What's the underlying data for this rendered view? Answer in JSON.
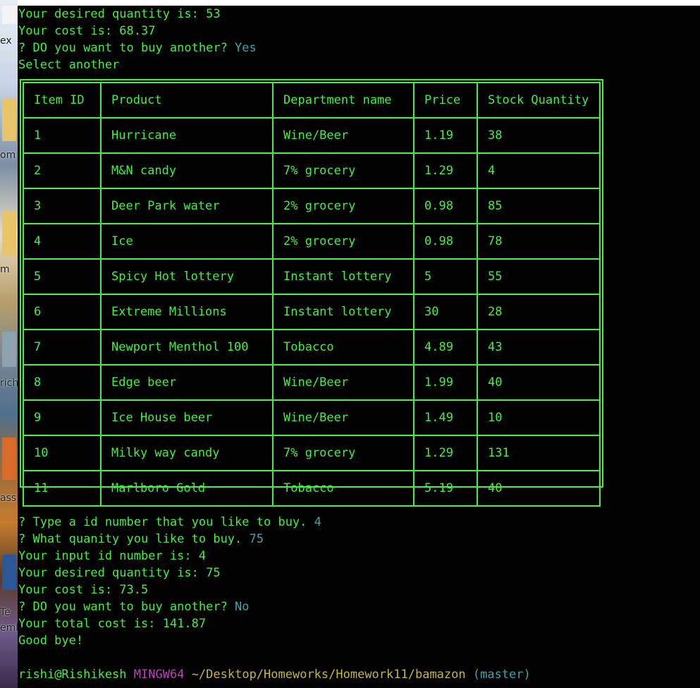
{
  "desktop": {
    "fragments": [
      "ex",
      "om",
      "m",
      "rich",
      "ass",
      "Te",
      "emb"
    ]
  },
  "terminal": {
    "top_lines": [
      {
        "text": "Your desired quantity is: 53"
      },
      {
        "text": "Your cost is: 68.37"
      },
      {
        "prefix": "? DO you want to buy another? ",
        "answer": "Yes"
      },
      {
        "text": "Select another"
      }
    ],
    "table": {
      "headers": [
        "Item ID",
        "Product",
        "Department name",
        "Price",
        "Stock Quantity"
      ],
      "rows": [
        [
          "1",
          "Hurricane",
          "Wine/Beer",
          "1.19",
          "38"
        ],
        [
          "2",
          "M&N candy",
          "7% grocery",
          "1.29",
          "4"
        ],
        [
          "3",
          "Deer Park water",
          "2% grocery",
          "0.98",
          "85"
        ],
        [
          "4",
          "Ice",
          "2% grocery",
          "0.98",
          "78"
        ],
        [
          "5",
          "Spicy Hot lottery",
          "Instant lottery",
          "5",
          "55"
        ],
        [
          "6",
          "Extreme Millions",
          "Instant lottery",
          "30",
          "28"
        ],
        [
          "7",
          "Newport Menthol 100",
          "Tobacco",
          "4.89",
          "43"
        ],
        [
          "8",
          "Edge beer",
          "Wine/Beer",
          "1.99",
          "40"
        ],
        [
          "9",
          "Ice House beer",
          "Wine/Beer",
          "1.49",
          "10"
        ],
        [
          "10",
          "Milky way candy",
          "7% grocery",
          "1.29",
          "131"
        ],
        [
          "11",
          "Marlboro Gold",
          "Tobacco",
          "5.19",
          "40"
        ]
      ]
    },
    "bottom_lines": [
      {
        "prefix": "? Type a id number that you like to buy. ",
        "answer": "4"
      },
      {
        "prefix": "? What quanity you like to buy. ",
        "answer": "75"
      },
      {
        "text": "Your input id number is: 4"
      },
      {
        "text": "Your desired quantity is: 75"
      },
      {
        "text": "Your cost is: 73.5"
      },
      {
        "prefix": "? DO you want to buy another? ",
        "answer": "No"
      },
      {
        "text": "Your total cost is: 141.87"
      },
      {
        "text": "Good bye!"
      }
    ],
    "prompt": {
      "user": "rishi@Rishikesh",
      "system": "MINGW64",
      "path": "~/Desktop/Homeworks/Homework11/bamazon",
      "branch": "(master)"
    }
  },
  "colors": {
    "terminal_text": "#3ef23e",
    "answer_text": "#3aa7b0",
    "mingw_label": "#c33ec3",
    "path_text": "#c8b830",
    "background": "#000000"
  }
}
